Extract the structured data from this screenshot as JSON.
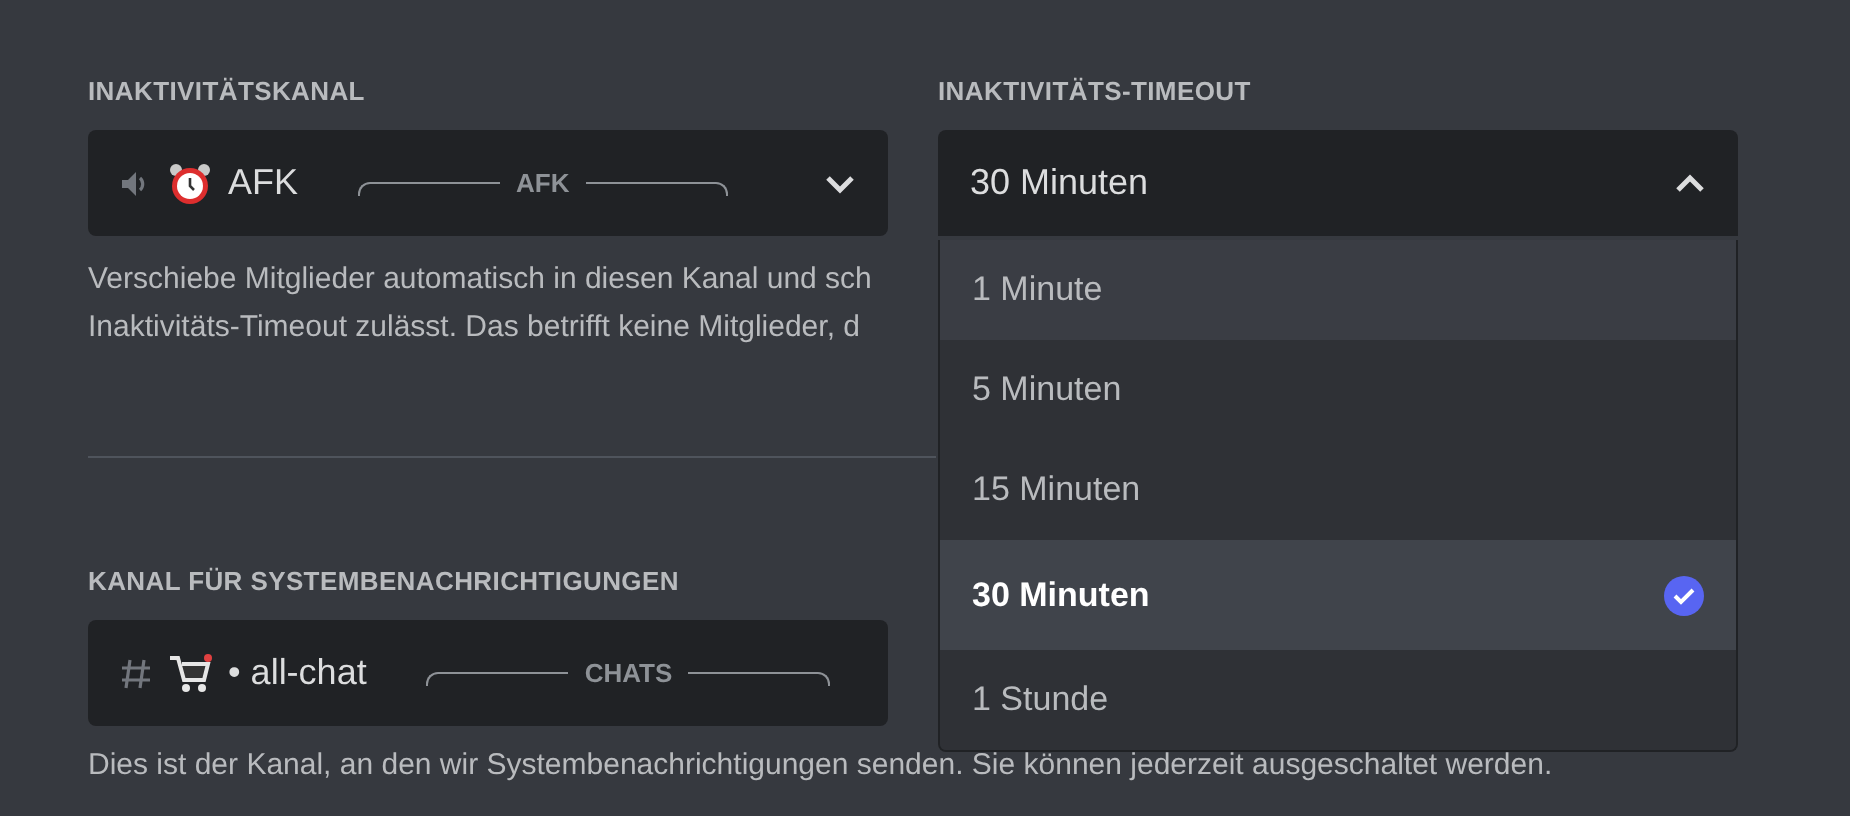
{
  "afk_channel": {
    "label": "INAKTIVITÄTSKANAL",
    "channel": {
      "kind": "voice",
      "name": "AFK",
      "category": "AFK"
    },
    "description_lines": [
      "Verschiebe Mitglieder automatisch in diesen Kanal und sch",
      "Inaktivitäts-Timeout zulässt. Das betrifft keine Mitglieder, d"
    ]
  },
  "afk_timeout": {
    "label": "INAKTIVITÄTS-TIMEOUT",
    "value": "30 Minuten",
    "expanded": true,
    "options": [
      {
        "label": "1 Minute",
        "hovered": true,
        "selected": false
      },
      {
        "label": "5 Minuten",
        "hovered": false,
        "selected": false
      },
      {
        "label": "15 Minuten",
        "hovered": false,
        "selected": false
      },
      {
        "label": "30 Minuten",
        "hovered": false,
        "selected": true
      },
      {
        "label": "1 Stunde",
        "hovered": false,
        "selected": false
      }
    ]
  },
  "system_channel": {
    "label": "KANAL FÜR SYSTEMBENACHRICHTIGUNGEN",
    "channel": {
      "kind": "text",
      "name": "• all-chat",
      "category": "CHATS"
    },
    "description": "Dies ist der Kanal, an den wir Systembenachrichtigungen senden. Sie können jederzeit ausgeschaltet werden."
  }
}
